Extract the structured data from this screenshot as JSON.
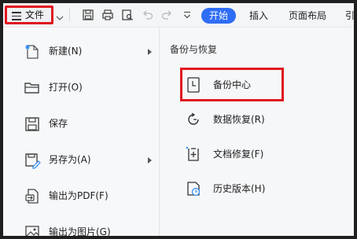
{
  "toolbar": {
    "file_label": "文件",
    "tabs": [
      "开始",
      "插入",
      "页面布局",
      "引"
    ]
  },
  "left_menu": {
    "items": [
      {
        "label": "新建(N)",
        "icon": "new-file-icon",
        "has_submenu": true
      },
      {
        "label": "打开(O)",
        "icon": "folder-open-icon",
        "has_submenu": false
      },
      {
        "label": "保存",
        "icon": "save-icon",
        "has_submenu": false
      },
      {
        "label": "另存为(A)",
        "icon": "save-as-icon",
        "has_submenu": true
      },
      {
        "label": "输出为PDF(F)",
        "icon": "export-pdf-icon",
        "has_submenu": false
      },
      {
        "label": "输出为图片(G)",
        "icon": "export-image-icon",
        "has_submenu": false
      }
    ]
  },
  "right_panel": {
    "title": "备份与恢复",
    "items": [
      {
        "label": "备份中心",
        "icon": "backup-center-icon",
        "highlighted": true
      },
      {
        "label": "数据恢复(R)",
        "icon": "data-recovery-icon"
      },
      {
        "label": "文档修复(F)",
        "icon": "document-repair-icon"
      },
      {
        "label": "历史版本(H)",
        "icon": "history-version-icon"
      }
    ]
  },
  "colors": {
    "accent": "#2f6df6",
    "highlight_border": "#e0161f"
  }
}
